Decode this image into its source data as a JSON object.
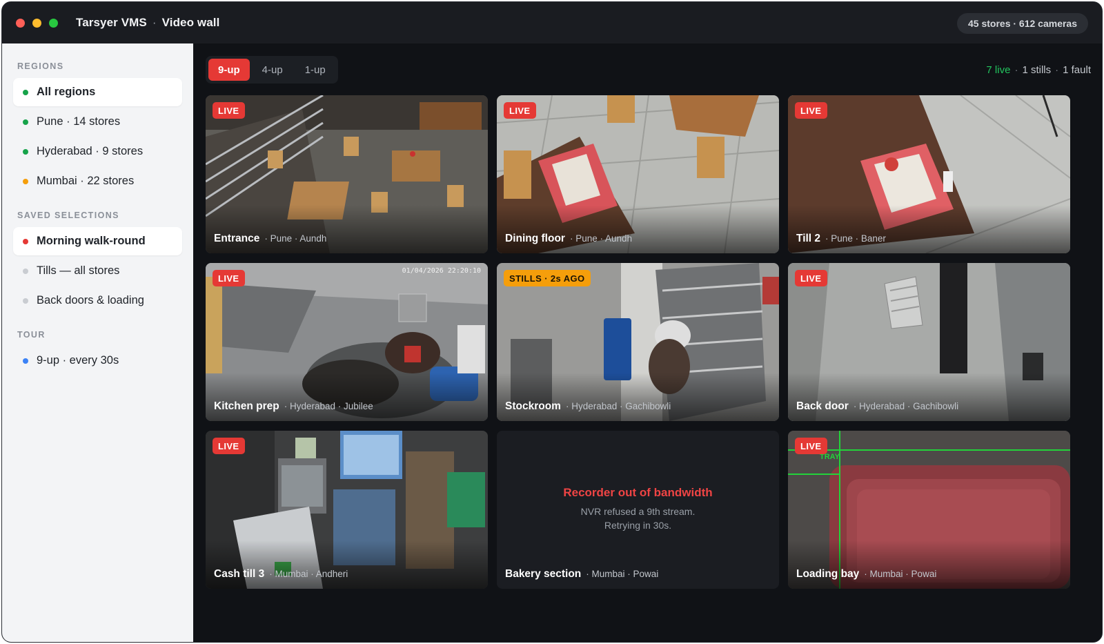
{
  "window": {
    "app_name": "Tarsyer VMS",
    "separator": "·",
    "view_title": "Video wall",
    "summary": "45 stores · 612 cameras"
  },
  "sidebar": {
    "regions_title": "REGIONS",
    "regions": [
      {
        "label": "All regions",
        "dot_color": "#16a34a",
        "active": true
      },
      {
        "label": "Pune · 14 stores",
        "dot_color": "#16a34a"
      },
      {
        "label": "Hyderabad · 9 stores",
        "dot_color": "#16a34a"
      },
      {
        "label": "Mumbai · 22 stores",
        "dot_color": "#f59e0b"
      }
    ],
    "saved_title": "SAVED SELECTIONS",
    "saved": [
      {
        "label": "Morning walk-round",
        "dot_color": "#e53935",
        "active": true
      },
      {
        "label": "Tills — all stores",
        "dot_color": "#c9ccd1"
      },
      {
        "label": "Back doors & loading",
        "dot_color": "#c9ccd1"
      }
    ],
    "tour_title": "TOUR",
    "tour": [
      {
        "label": "9-up · every 30s",
        "dot_color": "#3b82f6"
      }
    ]
  },
  "layout_toggle": {
    "options": [
      "9-up",
      "4-up",
      "1-up"
    ],
    "selected": "9-up"
  },
  "status": {
    "live": "7 live",
    "stills": "1 stills",
    "fault": "1 fault",
    "separator": "·"
  },
  "tiles": [
    {
      "name": "Entrance",
      "location": "· Pune · Aundh",
      "badge": "LIVE",
      "state": "live"
    },
    {
      "name": "Dining floor",
      "location": "· Pune · Aundh",
      "badge": "LIVE",
      "state": "live"
    },
    {
      "name": "Till 2",
      "location": "· Pune · Baner",
      "badge": "LIVE",
      "state": "live"
    },
    {
      "name": "Kitchen prep",
      "location": "· Hyderabad · Jubilee",
      "badge": "LIVE",
      "state": "live",
      "overlay_text": "01/04/2026 22:20:10"
    },
    {
      "name": "Stockroom",
      "location": "· Hyderabad · Gachibowli",
      "badge": "STILLS · 2s AGO",
      "state": "stills"
    },
    {
      "name": "Back door",
      "location": "· Hyderabad · Gachibowli",
      "badge": "LIVE",
      "state": "live"
    },
    {
      "name": "Cash till 3",
      "location": "· Mumbai · Andheri",
      "badge": "LIVE",
      "state": "live"
    },
    {
      "name": "Bakery section",
      "location": "· Mumbai · Powai",
      "state": "fault",
      "fault_title": "Recorder out of bandwidth",
      "fault_line1": "NVR refused a 9th stream.",
      "fault_line2": "Retrying in 30s."
    },
    {
      "name": "Loading bay",
      "location": "· Mumbai · Powai",
      "badge": "LIVE",
      "state": "live",
      "overlay_text": "TRAY"
    }
  ]
}
